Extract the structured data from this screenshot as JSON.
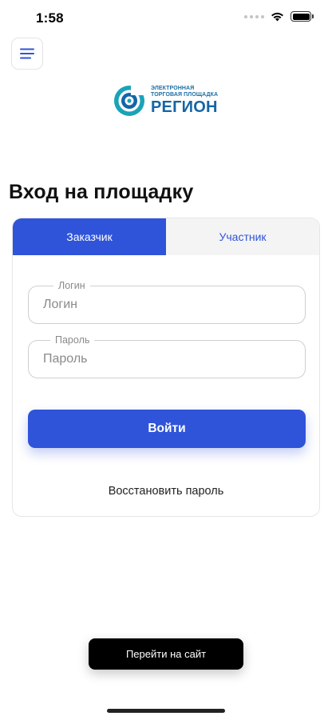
{
  "status_bar": {
    "time": "1:58"
  },
  "logo": {
    "line1": "ЭЛЕКТРОННАЯ",
    "line2": "ТОРГОВАЯ ПЛОЩАДКА",
    "name": "РЕГИОН"
  },
  "page": {
    "title": "Вход на площадку"
  },
  "tabs": [
    {
      "label": "Заказчик",
      "active": true
    },
    {
      "label": "Участник",
      "active": false
    }
  ],
  "form": {
    "login": {
      "label": "Логин",
      "placeholder": "Логин",
      "value": ""
    },
    "password": {
      "label": "Пароль",
      "placeholder": "Пароль",
      "value": ""
    },
    "submit_label": "Войти",
    "restore_label": "Восстановить пароль"
  },
  "footer": {
    "site_button_label": "Перейти на сайт"
  },
  "colors": {
    "accent": "#2f54d9",
    "logo_blue": "#1565a8",
    "logo_teal": "#1aa3b8"
  }
}
